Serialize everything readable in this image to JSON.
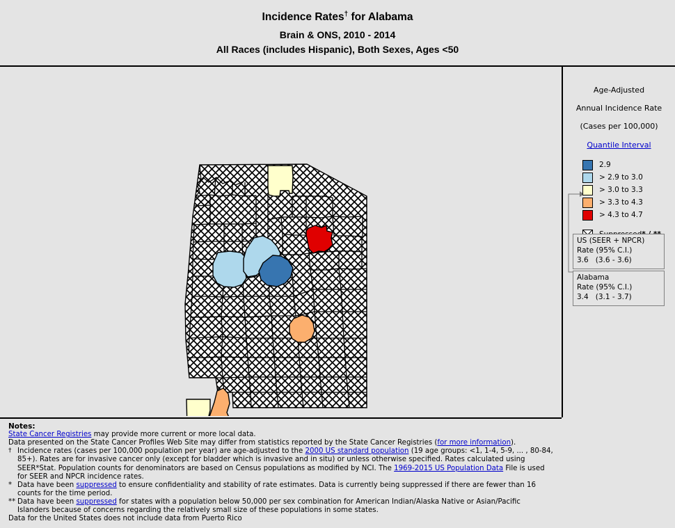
{
  "title": {
    "main_prefix": "Incidence Rates",
    "main_dagger": "†",
    "main_suffix": " for Alabama",
    "sub1": "Brain & ONS, 2010 - 2014",
    "sub2": "All Races (includes Hispanic), Both Sexes, Ages <50"
  },
  "legend": {
    "heading1": "Age-Adjusted",
    "heading2": "Annual Incidence Rate",
    "heading3": "(Cases per 100,000)",
    "interval_link": "Quantile Interval",
    "classes": [
      {
        "label": "2.9",
        "color": "#3775b0"
      },
      {
        "label": "> 2.9 to 3.0",
        "color": "#aed8ec"
      },
      {
        "label": "> 3.0 to 3.3",
        "color": "#ffffcc"
      },
      {
        "label": "> 3.3 to 4.3",
        "color": "#fcaf6e"
      },
      {
        "label": "> 4.3 to 4.7",
        "color": "#e00000"
      }
    ],
    "suppressed_label": "Suppressed",
    "suppressed_stars": "* / **",
    "us_box": {
      "title": "US (SEER + NPCR)",
      "rate_label": "Rate (95% C.I.)",
      "value": "3.6",
      "ci": "(3.6 - 3.6)"
    },
    "state_box": {
      "title": "Alabama",
      "rate_label": "Rate (95% C.I.)",
      "value": "3.4",
      "ci": "(3.1 - 3.7)"
    }
  },
  "notes": {
    "title": "Notes:",
    "line1_link": "State Cancer Registries",
    "line1_rest": " may provide more current or more local data.",
    "line2_a": "Data presented on the State Cancer Profiles Web Site may differ from statistics reported by the State Cancer Registries (",
    "line2_link": "for more information",
    "line2_b": ").",
    "dagger_marker": "†",
    "dagger_a": "Incidence rates (cases per 100,000 population per year) are age-adjusted to the ",
    "dagger_link1": "2000 US standard population",
    "dagger_b": " (19 age groups: <1, 1-4, 5-9, ... , 80-84, 85+). Rates are for invasive cancer only (except for bladder which is invasive and in situ) or unless otherwise specified. Rates calculated using SEER*Stat. Population counts for denominators are based on Census populations as modified  by NCI. The ",
    "dagger_link2": "1969-2015 US Population Data",
    "dagger_c": " File is used for SEER and NPCR incidence rates.",
    "star_marker": "*",
    "star_a": "Data have been  ",
    "star_link": "suppressed",
    "star_b": "  to ensure confidentiality and stability of rate estimates. Data is currently being suppressed if there are fewer than 16 counts for the time period.",
    "dstar_marker": "**",
    "dstar_a": "Data have been ",
    "dstar_link": "suppressed",
    "dstar_b": " for states with a population below 50,000 per sex combination for American Indian/Alaska Native or Asian/Pacific Islanders because of concerns regarding the relatively small size of these populations in some states.",
    "final": "Data for the United States does not include data from Puerto Rico"
  },
  "map": {
    "state": "Alabama",
    "suppressed_fill": "hatch",
    "counties": [
      {
        "name": "yellow-north",
        "class_index": 2,
        "color": "#ffffcc"
      },
      {
        "name": "red-east",
        "class_index": 4,
        "color": "#e00000"
      },
      {
        "name": "lightblue-west",
        "class_index": 1,
        "color": "#aed8ec"
      },
      {
        "name": "lightblue-center",
        "class_index": 1,
        "color": "#aed8ec"
      },
      {
        "name": "darkblue-center",
        "class_index": 0,
        "color": "#3775b0"
      },
      {
        "name": "orange-south",
        "class_index": 3,
        "color": "#fcaf6e"
      },
      {
        "name": "orange-southwest",
        "class_index": 3,
        "color": "#fcaf6e"
      },
      {
        "name": "yellow-southwest",
        "class_index": 2,
        "color": "#ffffcc"
      }
    ]
  }
}
